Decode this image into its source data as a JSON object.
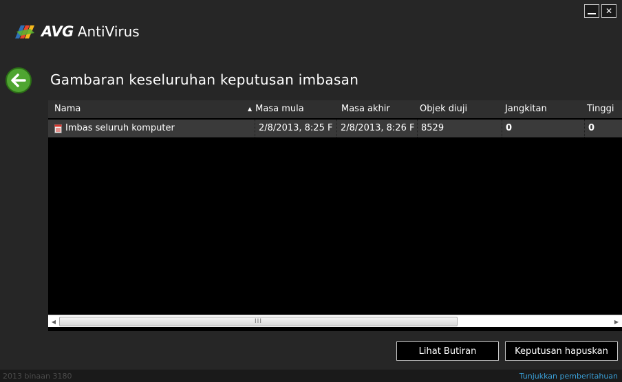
{
  "app": {
    "brand": "AVG",
    "product": "AntiVirus"
  },
  "page": {
    "title": "Gambaran keseluruhan keputusan imbasan"
  },
  "table": {
    "columns": [
      "Nama",
      "Masa mula",
      "Masa akhir",
      "Objek diuji",
      "Jangkitan",
      "Tinggi"
    ],
    "sorted_column": "Nama",
    "rows": [
      {
        "name": "Imbas seluruh komputer",
        "start": "2/8/2013, 8:25 F",
        "end": "2/8/2013, 8:26 F",
        "tested": "8529",
        "infections": "0",
        "high": "0"
      }
    ],
    "scroll_grip": "III"
  },
  "buttons": {
    "details": "Lihat Butiran",
    "delete": "Keputusan hapuskan"
  },
  "statusbar": {
    "version": "2013  binaan 3180",
    "notifications_link": "Tunjukkan pemberitahuan"
  },
  "colors": {
    "background": "#262626",
    "accent_green": "#4fa531",
    "link_blue": "#3aa0d8",
    "row_bg": "#3a3a3a",
    "header_bg": "#2f2f2f"
  },
  "icons": {
    "back": "arrow-left-icon",
    "row": "document-report-icon",
    "minimize": "minimize-icon",
    "close": "close-icon"
  }
}
